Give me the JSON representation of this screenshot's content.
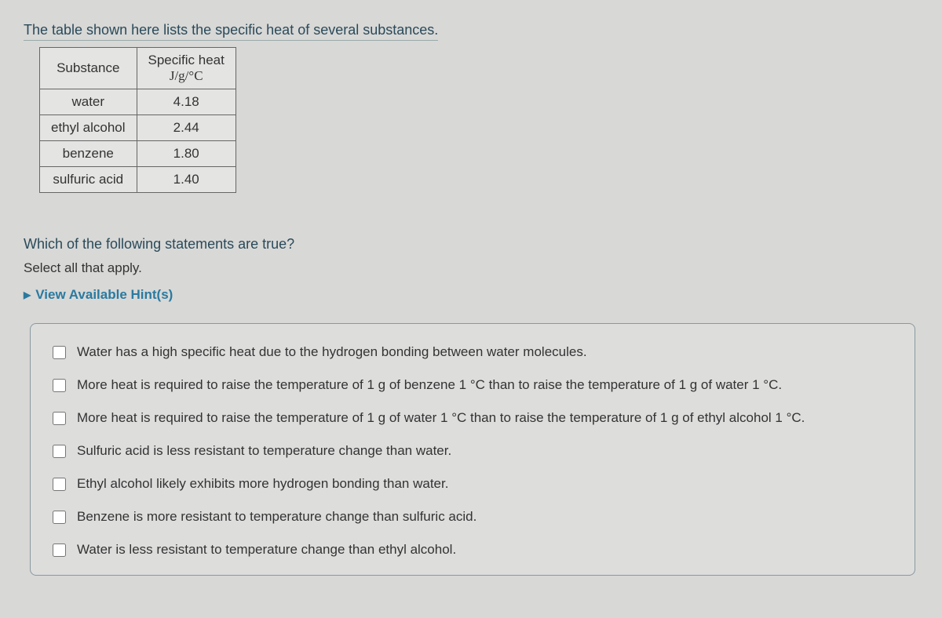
{
  "intro": "The table shown here lists the specific heat of several substances.",
  "table": {
    "headers": {
      "substance": "Substance",
      "specific_heat_line1": "Specific heat",
      "specific_heat_line2": "J/g/°C"
    },
    "rows": [
      {
        "substance": "water",
        "value": "4.18"
      },
      {
        "substance": "ethyl alcohol",
        "value": "2.44"
      },
      {
        "substance": "benzene",
        "value": "1.80"
      },
      {
        "substance": "sulfuric acid",
        "value": "1.40"
      }
    ]
  },
  "question": "Which of the following statements are true?",
  "select_all": "Select all that apply.",
  "hints_label": "View Available Hint(s)",
  "options": [
    "Water has a high specific heat due to the hydrogen bonding between water molecules.",
    "More heat is required to raise the temperature of 1 g of benzene 1 °C than to raise the temperature of 1 g of water 1 °C.",
    "More heat is required to raise the temperature of 1 g of water 1 °C than to raise the temperature of 1 g of ethyl alcohol 1 °C.",
    "Sulfuric acid is less resistant to temperature change than water.",
    "Ethyl alcohol likely exhibits more hydrogen bonding than water.",
    "Benzene is more resistant to temperature change than sulfuric acid.",
    "Water is less resistant to temperature change than ethyl alcohol."
  ]
}
